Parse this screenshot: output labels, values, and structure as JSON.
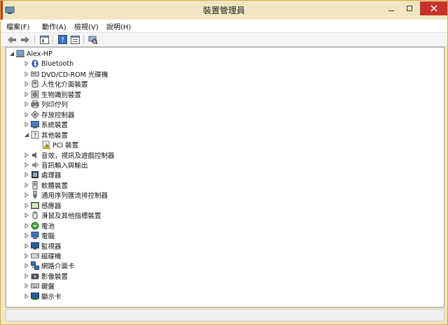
{
  "window": {
    "title": "裝置管理員",
    "accent": "#c7332b"
  },
  "menu": [
    {
      "label": "檔案(F)"
    },
    {
      "label": "動作(A)"
    },
    {
      "label": "檢視(V)"
    },
    {
      "label": "說明(H)"
    }
  ],
  "toolbar": [
    "back-icon",
    "forward-icon",
    "properties-icon",
    "help-icon",
    "show-hidden-icon",
    "scan-hardware-icon"
  ],
  "tree": {
    "root": "Alex-HP",
    "items": [
      {
        "label": "Bluetooth",
        "icon": "bluetooth-icon"
      },
      {
        "label": "DVD/CD-ROM 光碟機",
        "icon": "dvd-drive-icon"
      },
      {
        "label": "人性化介面裝置",
        "icon": "hid-icon"
      },
      {
        "label": "生物識別裝置",
        "icon": "fingerprint-icon"
      },
      {
        "label": "列印佇列",
        "icon": "printer-icon"
      },
      {
        "label": "存放控制器",
        "icon": "storage-controller-icon"
      },
      {
        "label": "系統裝置",
        "icon": "system-device-icon"
      },
      {
        "label": "其他裝置",
        "icon": "unknown-device-icon",
        "expanded": true,
        "children": [
          {
            "label": "PCI 裝置",
            "icon": "warning-device-icon"
          }
        ]
      },
      {
        "label": "音效，視訊及遊戲控制器",
        "icon": "speaker-icon"
      },
      {
        "label": "音訊輸入與輸出",
        "icon": "audio-io-icon"
      },
      {
        "label": "處理器",
        "icon": "processor-icon"
      },
      {
        "label": "軟體裝置",
        "icon": "software-device-icon"
      },
      {
        "label": "通用序列匯流排控制器",
        "icon": "usb-icon"
      },
      {
        "label": "感應器",
        "icon": "sensor-icon"
      },
      {
        "label": "滑鼠及其他指標裝置",
        "icon": "mouse-icon"
      },
      {
        "label": "電池",
        "icon": "battery-icon"
      },
      {
        "label": "電腦",
        "icon": "computer-icon"
      },
      {
        "label": "監視器",
        "icon": "monitor-icon"
      },
      {
        "label": "磁碟機",
        "icon": "disk-drive-icon"
      },
      {
        "label": "網路介面卡",
        "icon": "network-adapter-icon"
      },
      {
        "label": "影像裝置",
        "icon": "camera-icon"
      },
      {
        "label": "鍵盤",
        "icon": "keyboard-icon"
      },
      {
        "label": "顯示卡",
        "icon": "display-adapter-icon"
      }
    ]
  }
}
